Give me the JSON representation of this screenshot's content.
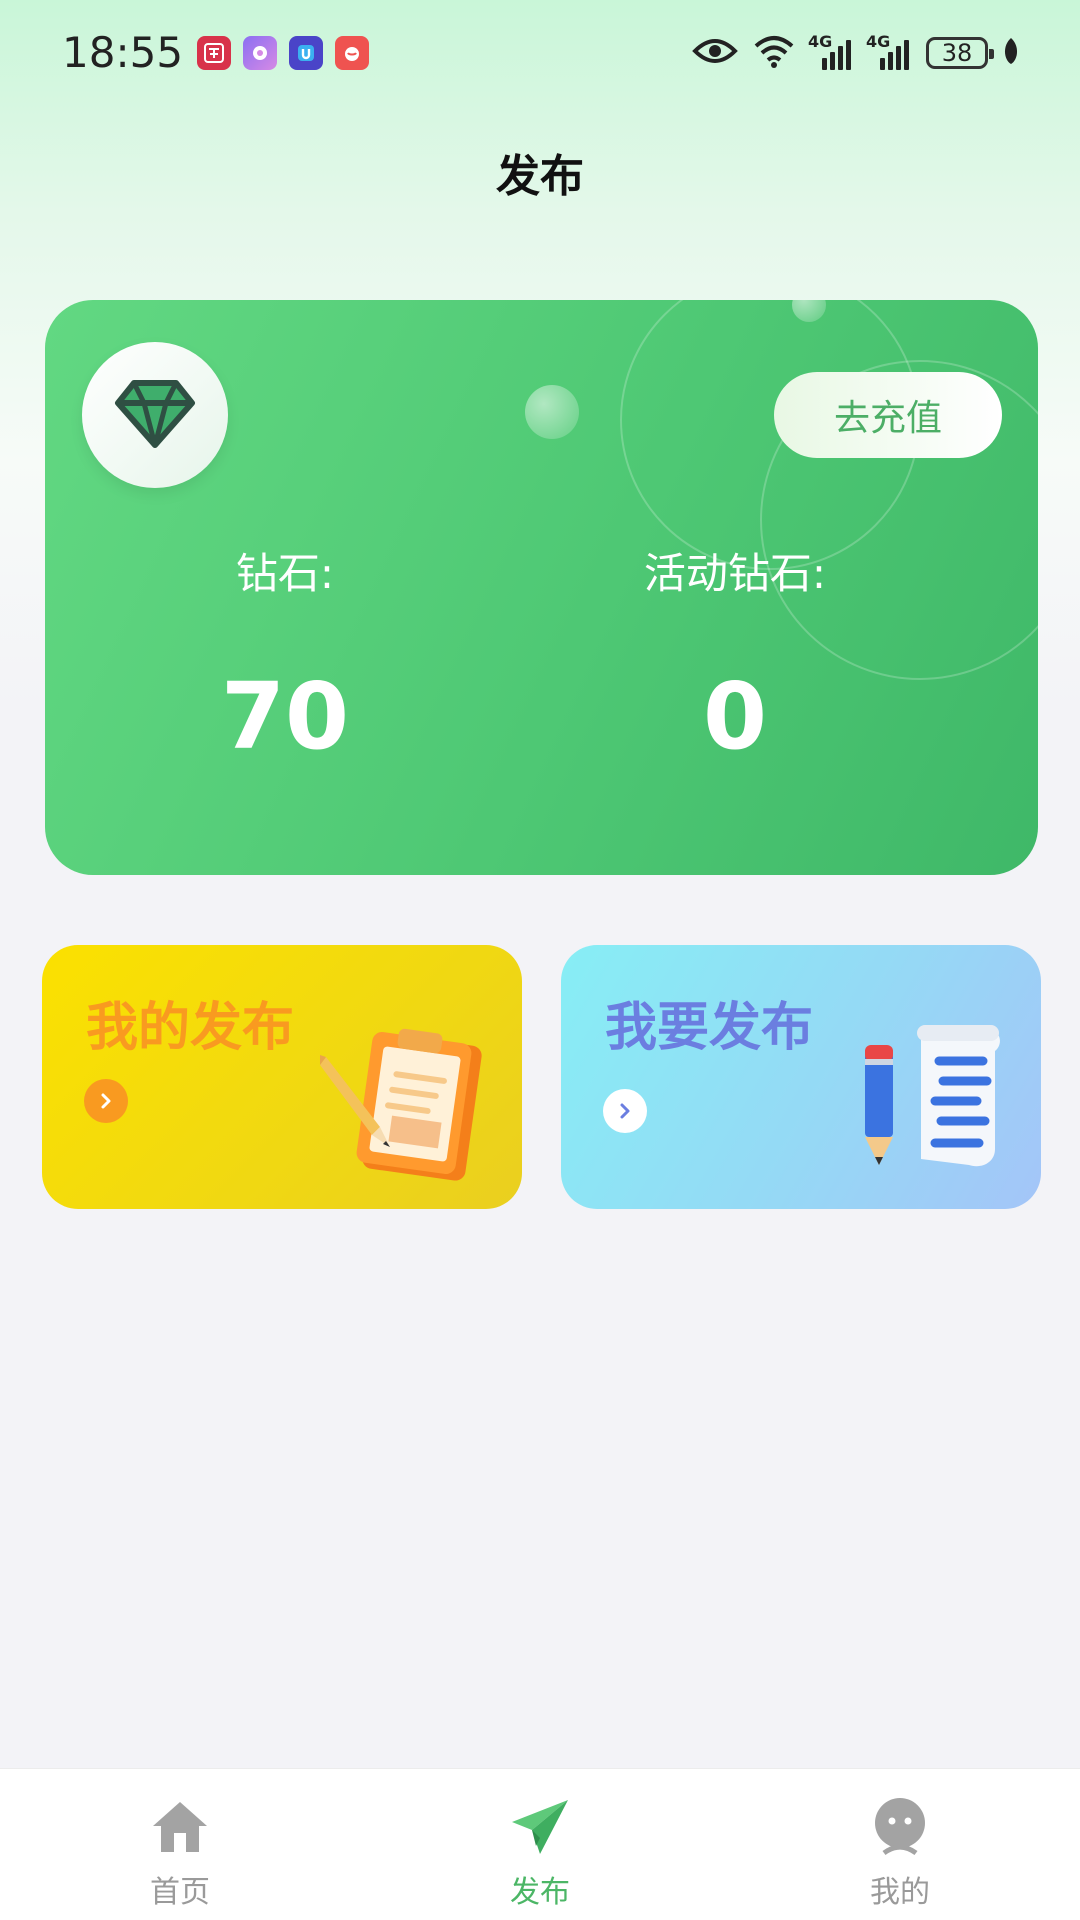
{
  "status_bar": {
    "time": "18:55",
    "app_icons": [
      "taobao-icon",
      "app-purple-icon",
      "app-blue-u-icon",
      "app-red-icon"
    ],
    "signal_label_1": "4G",
    "signal_label_2": "4G",
    "battery": "38"
  },
  "page": {
    "title": "发布"
  },
  "diamond_card": {
    "recharge_label": "去充值",
    "diamond_label": "钻石:",
    "diamond_value": "70",
    "activity_label": "活动钻石:",
    "activity_value": "0"
  },
  "actions": {
    "my_posts": {
      "title": "我的发布"
    },
    "new_post": {
      "title": "我要发布"
    }
  },
  "tab_bar": {
    "items": [
      {
        "label": "首页",
        "icon": "home-icon"
      },
      {
        "label": "发布",
        "icon": "paper-plane-icon"
      },
      {
        "label": "我的",
        "icon": "profile-icon"
      }
    ],
    "active": "发布"
  },
  "colors": {
    "accent_green": "#4cb666",
    "card_green": "#52c978",
    "yellow_card": "#f4dc10",
    "orange_text": "#f99a20",
    "blue_card": "#95d9f5",
    "blue_text": "#6b7ee0"
  }
}
